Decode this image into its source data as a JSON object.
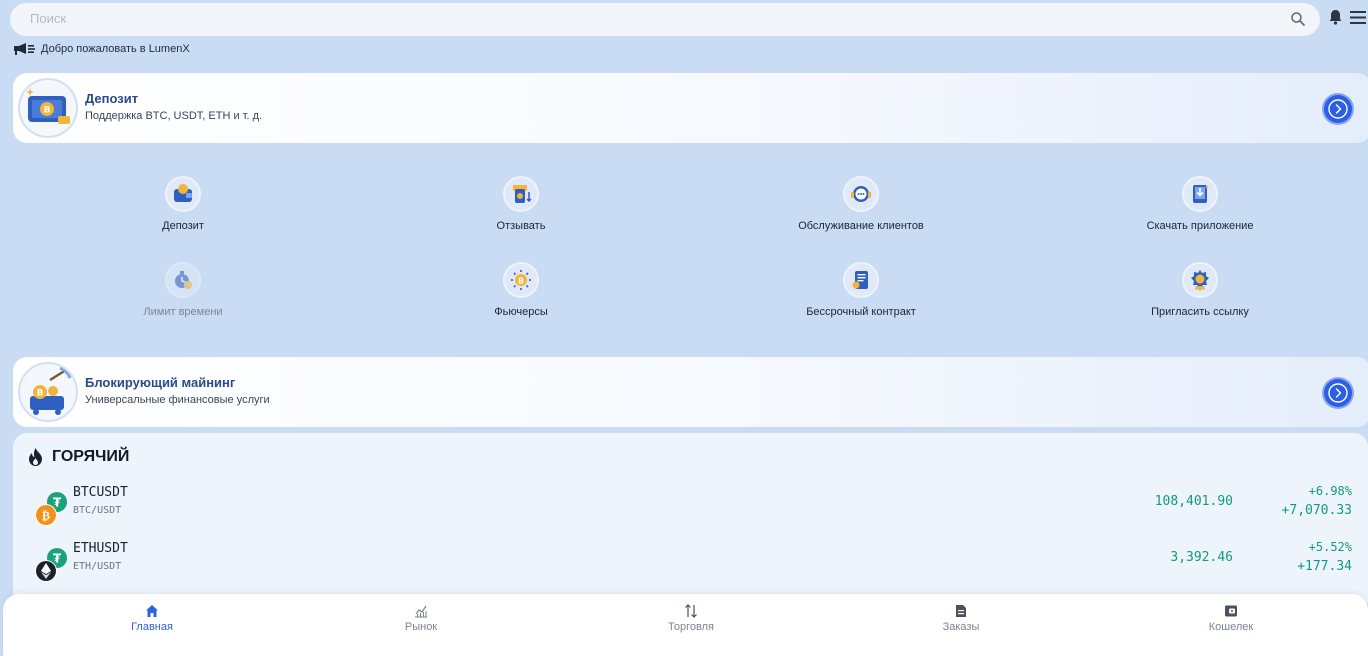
{
  "search": {
    "placeholder": "Поиск"
  },
  "welcome_text": "Добро пожаловать в LumenX",
  "deposit_banner": {
    "title": "Депозит",
    "subtitle": "Поддержка BTC, USDT, ETH и т. д."
  },
  "features": [
    {
      "label": "Депозит",
      "icon": "deposit-wallet-icon"
    },
    {
      "label": "Отзывать",
      "icon": "withdraw-icon"
    },
    {
      "label": "Обслуживание клиентов",
      "icon": "customer-service-icon"
    },
    {
      "label": "Скачать приложение",
      "icon": "download-app-icon"
    },
    {
      "label": "Лимит времени",
      "icon": "time-limit-icon"
    },
    {
      "label": "Фьючерсы",
      "icon": "futures-icon"
    },
    {
      "label": "Бессрочный контракт",
      "icon": "perpetual-contract-icon"
    },
    {
      "label": "Пригласить ссылку",
      "icon": "invite-link-icon"
    }
  ],
  "mining_banner": {
    "title": "Блокирующий майнинг",
    "subtitle": "Универсальные финансовые услуги"
  },
  "hot": {
    "title": "ГОРЯЧИЙ",
    "rows": [
      {
        "symbol": "BTCUSDT",
        "pair": "BTC/USDT",
        "price": "108,401.90",
        "percent": "+6.98%",
        "change": "+7,070.33",
        "coin_icon": "bitcoin-icon"
      },
      {
        "symbol": "ETHUSDT",
        "pair": "ETH/USDT",
        "price": "3,392.46",
        "percent": "+5.52%",
        "change": "+177.34",
        "coin_icon": "ethereum-icon"
      }
    ]
  },
  "nav": [
    {
      "label": "Главная",
      "icon": "home-icon",
      "active": true
    },
    {
      "label": "Рынок",
      "icon": "market-chart-icon",
      "active": false
    },
    {
      "label": "Торговля",
      "icon": "trade-arrows-icon",
      "active": false
    },
    {
      "label": "Заказы",
      "icon": "orders-document-icon",
      "active": false
    },
    {
      "label": "Кошелек",
      "icon": "wallet-icon",
      "active": false
    }
  ],
  "colors": {
    "background": "#c9dcf3",
    "accent": "#3164d8",
    "positive": "#129a7d",
    "banner_title": "#2a4a8e"
  }
}
